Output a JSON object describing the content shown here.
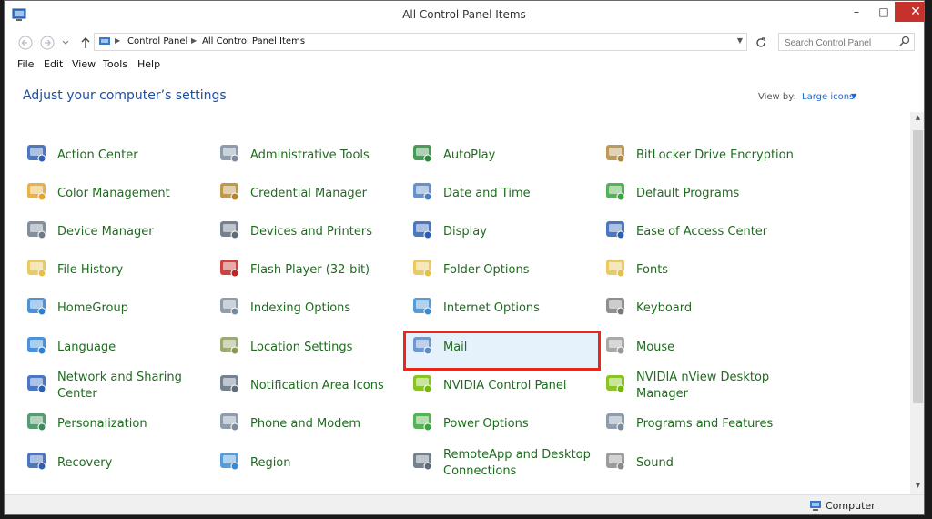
{
  "window": {
    "title": "All Control Panel Items",
    "minimize": "–",
    "maximize": "□",
    "close": "✕"
  },
  "address": {
    "breadcrumbs": [
      "Control Panel",
      "All Control Panel Items"
    ],
    "search_placeholder": "Search Control Panel"
  },
  "menu": [
    "File",
    "Edit",
    "View",
    "Tools",
    "Help"
  ],
  "heading": "Adjust your computer’s settings",
  "view_by": {
    "label": "View by:",
    "value": "Large icons"
  },
  "items": [
    {
      "label": "Action Center",
      "icon": "flag-icon",
      "color": "#2b5fb5"
    },
    {
      "label": "Administrative Tools",
      "icon": "admin-tools-icon",
      "color": "#7a8b9c"
    },
    {
      "label": "AutoPlay",
      "icon": "autoplay-icon",
      "color": "#2a8a3a"
    },
    {
      "label": "BitLocker Drive Encryption",
      "icon": "keys-icon",
      "color": "#b08a3a"
    },
    {
      "label": "Color Management",
      "icon": "color-management-icon",
      "color": "#e3a52b"
    },
    {
      "label": "Credential Manager",
      "icon": "vault-icon",
      "color": "#b3862c"
    },
    {
      "label": "Date and Time",
      "icon": "calendar-clock-icon",
      "color": "#4b7fc2"
    },
    {
      "label": "Default Programs",
      "icon": "default-programs-icon",
      "color": "#3aa53a"
    },
    {
      "label": "Device Manager",
      "icon": "device-manager-icon",
      "color": "#6b7b8b"
    },
    {
      "label": "Devices and Printers",
      "icon": "printer-icon",
      "color": "#5c6c7c"
    },
    {
      "label": "Display",
      "icon": "monitor-icon",
      "color": "#2b5fb5"
    },
    {
      "label": "Ease of Access Center",
      "icon": "ease-of-access-icon",
      "color": "#2b5fb5"
    },
    {
      "label": "File History",
      "icon": "file-history-icon",
      "color": "#e6c14a"
    },
    {
      "label": "Flash Player (32-bit)",
      "icon": "flash-icon",
      "color": "#c3231f"
    },
    {
      "label": "Folder Options",
      "icon": "folder-options-icon",
      "color": "#e6c14a"
    },
    {
      "label": "Fonts",
      "icon": "fonts-icon",
      "color": "#e6c14a"
    },
    {
      "label": "HomeGroup",
      "icon": "homegroup-icon",
      "color": "#2b7fd0"
    },
    {
      "label": "Indexing Options",
      "icon": "magnifier-icon",
      "color": "#7a8b9c"
    },
    {
      "label": "Internet Options",
      "icon": "globe-icon",
      "color": "#3a8ad0"
    },
    {
      "label": "Keyboard",
      "icon": "keyboard-icon",
      "color": "#7a7a7a"
    },
    {
      "label": "Language",
      "icon": "language-icon",
      "color": "#2b7fd0"
    },
    {
      "label": "Location Settings",
      "icon": "location-icon",
      "color": "#8a9a5a"
    },
    {
      "label": "Mail",
      "icon": "mail-icon",
      "color": "#5b8ac6"
    },
    {
      "label": "Mouse",
      "icon": "mouse-icon",
      "color": "#9a9a9a"
    },
    {
      "label": "Network and Sharing Center",
      "icon": "network-icon",
      "color": "#2b5fb5"
    },
    {
      "label": "Notification Area Icons",
      "icon": "notification-icon",
      "color": "#5c6c7c"
    },
    {
      "label": "NVIDIA Control Panel",
      "icon": "nvidia-icon",
      "color": "#76b900"
    },
    {
      "label": "NVIDIA nView Desktop Manager",
      "icon": "nvidia-eye-icon",
      "color": "#76b900"
    },
    {
      "label": "Personalization",
      "icon": "personalization-icon",
      "color": "#3a8a5a"
    },
    {
      "label": "Phone and Modem",
      "icon": "phone-icon",
      "color": "#7a8b9c"
    },
    {
      "label": "Power Options",
      "icon": "power-icon",
      "color": "#3aa53a"
    },
    {
      "label": "Programs and Features",
      "icon": "programs-icon",
      "color": "#7a8b9c"
    },
    {
      "label": "Recovery",
      "icon": "recovery-icon",
      "color": "#2b5fb5"
    },
    {
      "label": "Region",
      "icon": "region-globe-icon",
      "color": "#3a8ad0"
    },
    {
      "label": "RemoteApp and Desktop Connections",
      "icon": "remoteapp-icon",
      "color": "#5c6c7c"
    },
    {
      "label": "Sound",
      "icon": "speaker-icon",
      "color": "#8a8a8a"
    }
  ],
  "selected_item": "Mail",
  "status": {
    "text": "Computer"
  }
}
